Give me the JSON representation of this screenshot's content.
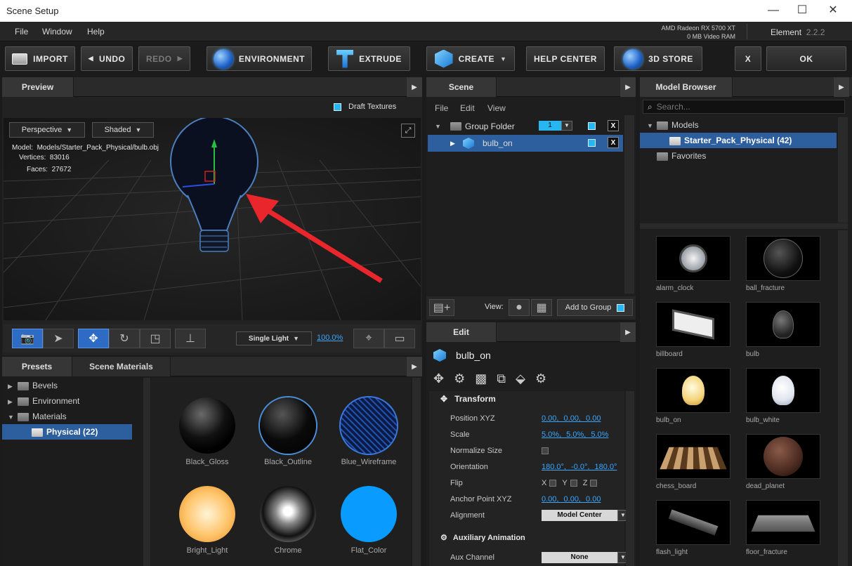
{
  "window": {
    "title": "Scene Setup",
    "minimize": "—",
    "maximize": "☐",
    "close": "✕"
  },
  "menubar": {
    "items": [
      "File",
      "Window",
      "Help"
    ],
    "gpu_name": "AMD Radeon RX 5700 XT",
    "gpu_mem": "0 MB Video RAM",
    "app_name": "Element",
    "app_version": "2.2.2"
  },
  "toolbar": {
    "import": "IMPORT",
    "undo": "UNDO",
    "redo": "REDO",
    "environment": "ENVIRONMENT",
    "extrude": "EXTRUDE",
    "create": "CREATE",
    "help_center": "HELP CENTER",
    "store": "3D STORE",
    "x": "X",
    "ok": "OK"
  },
  "preview": {
    "tab": "Preview",
    "draft_textures": "Draft Textures",
    "projection": "Perspective",
    "shading": "Shaded",
    "model_label": "Model:",
    "model_value": "Models/Starter_Pack_Physical/bulb.obj",
    "vertices_label": "Vertices:",
    "vertices_value": "83016",
    "faces_label": "Faces:",
    "faces_value": "27672",
    "lighting": "Single Light",
    "zoom": "100.0%"
  },
  "presets": {
    "tabs": [
      "Presets",
      "Scene Materials"
    ],
    "tree": [
      {
        "label": "Bevels",
        "expanded": false
      },
      {
        "label": "Environment",
        "expanded": false
      },
      {
        "label": "Materials",
        "expanded": true
      },
      {
        "label": "Physical (22)",
        "selected": true
      }
    ],
    "materials": [
      "Black_Gloss",
      "Black_Outline",
      "Blue_Wireframe",
      "Bright_Light",
      "Chrome",
      "Flat_Color"
    ]
  },
  "scene": {
    "tab": "Scene",
    "menu": [
      "File",
      "Edit",
      "View"
    ],
    "group_folder": "Group Folder",
    "group_number": "1",
    "item": "bulb_on",
    "view_label": "View:",
    "add_to_group": "Add to Group",
    "x": "X"
  },
  "edit": {
    "tab": "Edit",
    "object_name": "bulb_on",
    "transform_title": "Transform",
    "props": {
      "position_label": "Position XYZ",
      "position_value": "0.00, 0.00, 0.00",
      "scale_label": "Scale",
      "scale_value": "5.0%, 5.0%, 5.0%",
      "normalize_label": "Normalize Size",
      "orientation_label": "Orientation",
      "orientation_value": "180.0°, -0.0°, 180.0°",
      "flip_label": "Flip",
      "flip_x": "X",
      "flip_y": "Y",
      "flip_z": "Z",
      "anchor_label": "Anchor Point XYZ",
      "anchor_value": "0.00, 0.00, 0.00",
      "alignment_label": "Alignment",
      "alignment_value": "Model Center"
    },
    "aux_title": "Auxiliary Animation",
    "aux_channel_label": "Aux Channel",
    "aux_channel_value": "None"
  },
  "browser": {
    "tab": "Model Browser",
    "search_placeholder": "Search...",
    "tree": [
      {
        "label": "Models"
      },
      {
        "label": "Starter_Pack_Physical (42)",
        "selected": true
      },
      {
        "label": "Favorites"
      }
    ],
    "models": [
      "alarm_clock",
      "ball_fracture",
      "billboard",
      "bulb",
      "bulb_on",
      "bulb_white",
      "chess_board",
      "dead_planet",
      "flash_light",
      "floor_fracture"
    ]
  },
  "colors": {
    "accent": "#27b6f2",
    "selection": "#2d5e9e",
    "arrow": "#e8262b"
  }
}
